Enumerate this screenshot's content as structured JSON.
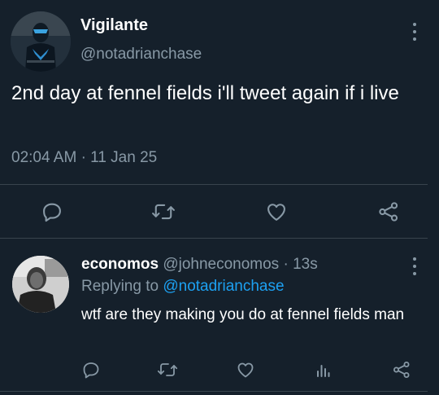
{
  "tweet": {
    "author_name": "Vigilante",
    "author_handle": "@notadrianchase",
    "text": "2nd day at fennel fields i'll tweet again if i live",
    "time": "02:04 AM",
    "separator": "·",
    "date": "11 Jan 25"
  },
  "actions": {
    "icons": [
      "reply-icon",
      "retweet-icon",
      "like-icon",
      "share-icon"
    ]
  },
  "reply": {
    "author_name": "economos",
    "author_handle": "@johneconomos",
    "separator": "·",
    "time_ago": "13s",
    "replying_prefix": "Replying to ",
    "replying_to": "@notadrianchase",
    "text": "wtf are they making you do at fennel fields man",
    "icons": [
      "reply-icon",
      "retweet-icon",
      "like-icon",
      "analytics-icon",
      "share-icon"
    ]
  },
  "colors": {
    "background": "#15202b",
    "text_primary": "#ffffff",
    "text_secondary": "#8899a6",
    "link": "#1da1f2",
    "divider": "#38444d"
  }
}
